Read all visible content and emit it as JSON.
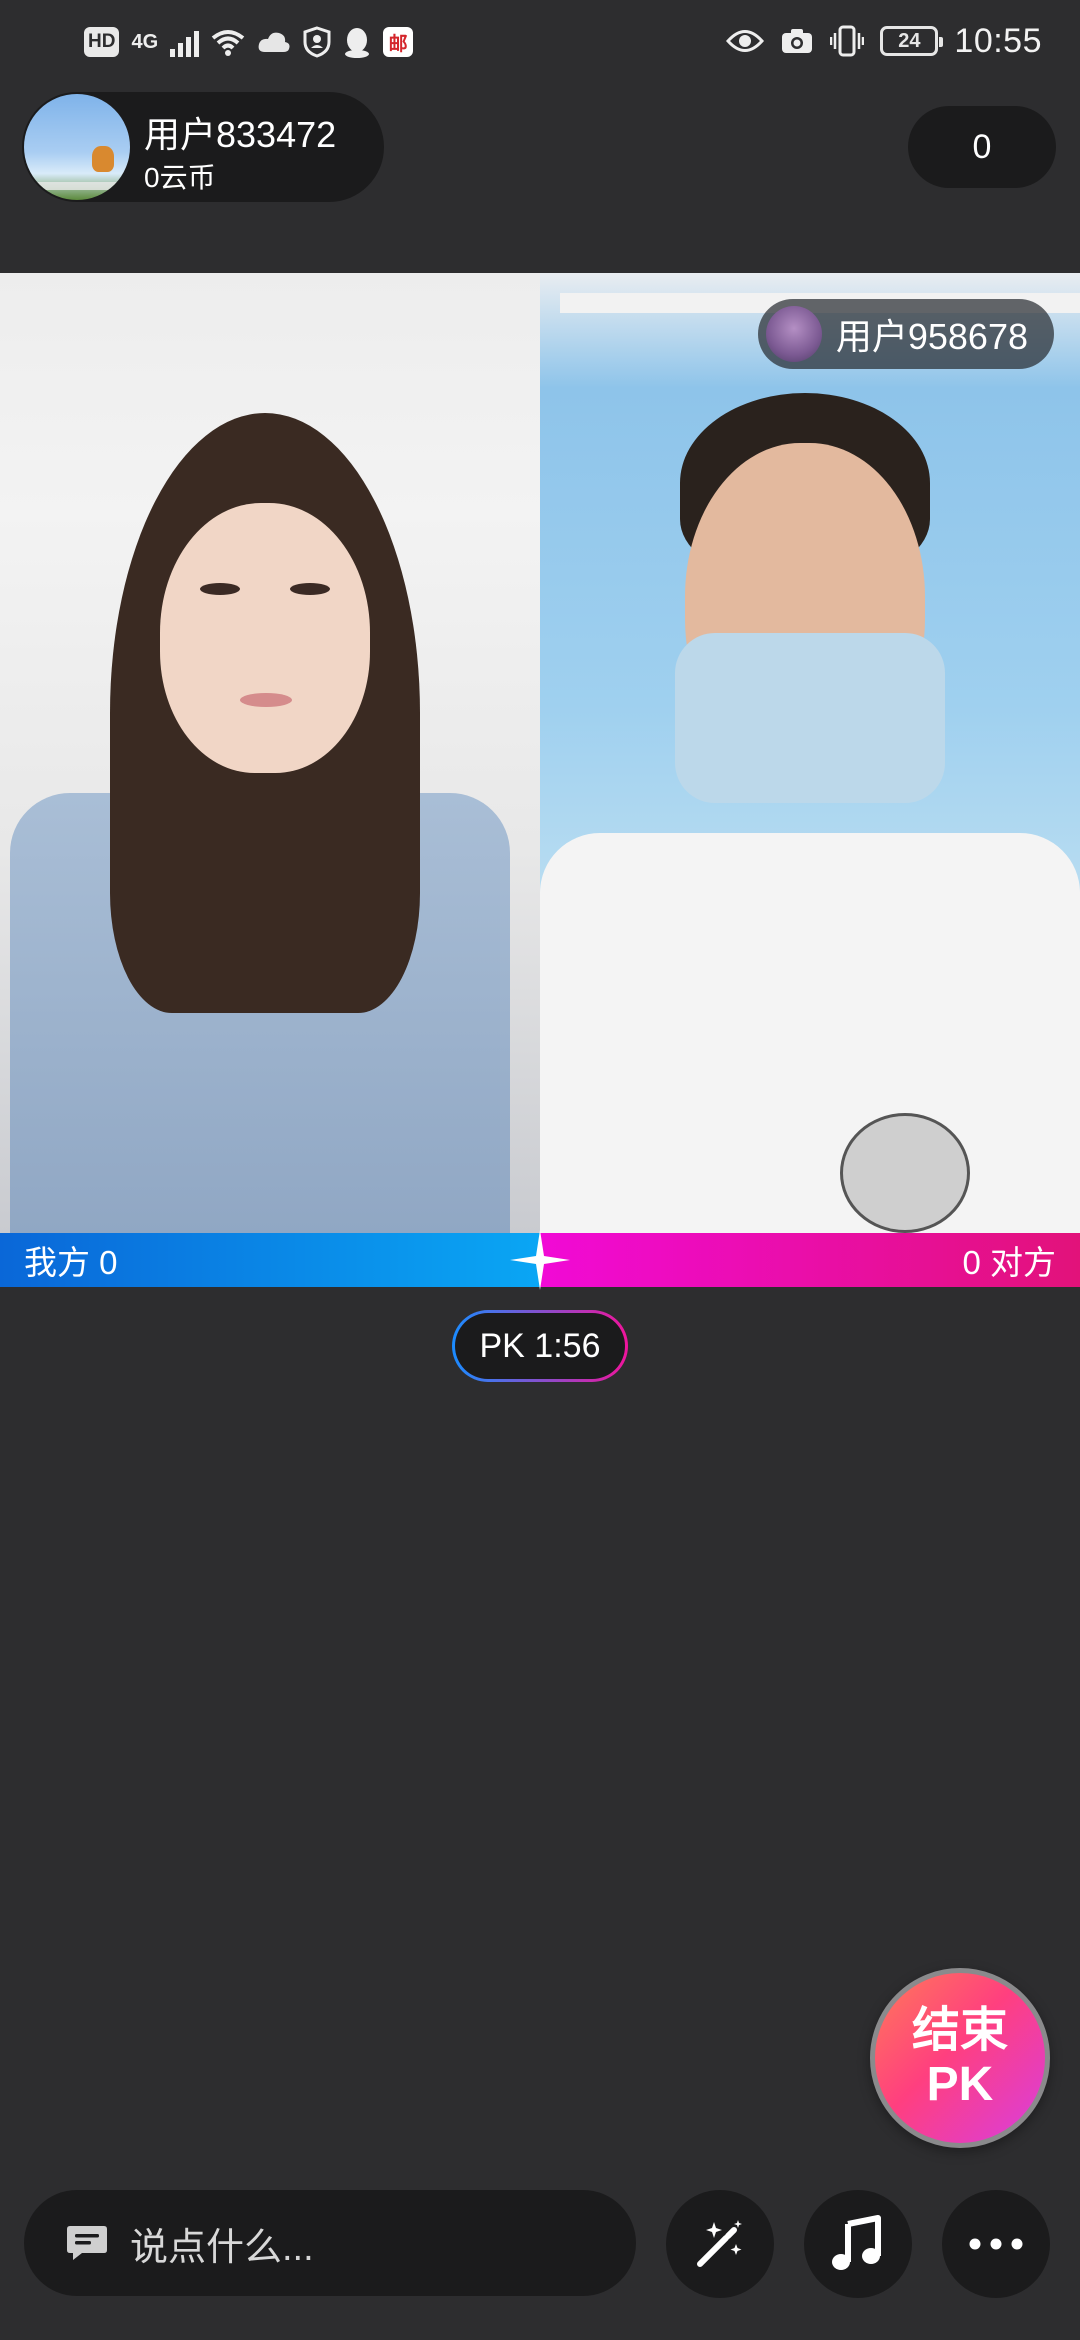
{
  "status_bar": {
    "left_badges": [
      "HD",
      "4G"
    ],
    "mail_badge": "邮",
    "battery_level": "24",
    "time": "10:55"
  },
  "header": {
    "user_name": "用户833472",
    "user_coins": "0云币",
    "score": "0"
  },
  "remote": {
    "user_name": "用户958678"
  },
  "pk_bar": {
    "left_label": "我方 0",
    "right_label": "0 对方",
    "left_color": "#0a86ec",
    "right_color": "#f10ab0"
  },
  "pk_timer": "PK 1:56",
  "end_pk": {
    "line1": "结束",
    "line2": "PK"
  },
  "bottom_bar": {
    "chat_placeholder": "说点什么...",
    "buttons": [
      "magic-wand-icon",
      "music-note-icon",
      "more-icon"
    ]
  }
}
